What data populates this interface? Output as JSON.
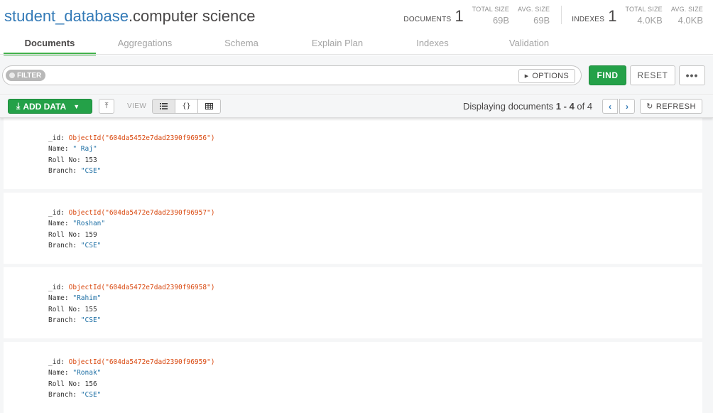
{
  "title": {
    "database": "student_database",
    "collection": ".computer science"
  },
  "stats": {
    "documents_label": "DOCUMENTS",
    "documents_count": "1",
    "doc_total_size_label": "TOTAL SIZE",
    "doc_total_size": "69B",
    "doc_avg_size_label": "AVG. SIZE",
    "doc_avg_size": "69B",
    "indexes_label": "INDEXES",
    "indexes_count": "1",
    "idx_total_size_label": "TOTAL SIZE",
    "idx_total_size": "4.0KB",
    "idx_avg_size_label": "AVG. SIZE",
    "idx_avg_size": "4.0KB"
  },
  "tabs": [
    {
      "label": "Documents",
      "active": true
    },
    {
      "label": "Aggregations"
    },
    {
      "label": "Schema"
    },
    {
      "label": "Explain Plan"
    },
    {
      "label": "Indexes"
    },
    {
      "label": "Validation"
    }
  ],
  "query": {
    "filter_label": "FILTER",
    "filter_value": "",
    "options_label": "OPTIONS",
    "find_label": "FIND",
    "reset_label": "RESET",
    "more_label": "•••"
  },
  "toolbar": {
    "add_data_label": "ADD DATA",
    "view_label": "VIEW",
    "view_modes": [
      "list",
      "json",
      "table"
    ],
    "displaying_prefix": "Displaying documents ",
    "range": "1 - 4",
    "of_text": " of ",
    "total": "4",
    "refresh_label": "REFRESH"
  },
  "field_labels": {
    "id": "_id:",
    "name": "Name:",
    "roll": "Roll No:",
    "branch": "Branch:"
  },
  "documents": [
    {
      "id": "ObjectId(\"604da5452e7dad2390f96956\")",
      "name": "\" Raj\"",
      "roll": "153",
      "branch": "\"CSE\""
    },
    {
      "id": "ObjectId(\"604da5472e7dad2390f96957\")",
      "name": "\"Roshan\"",
      "roll": "159",
      "branch": "\"CSE\""
    },
    {
      "id": "ObjectId(\"604da5472e7dad2390f96958\")",
      "name": "\"Rahim\"",
      "roll": "155",
      "branch": "\"CSE\""
    },
    {
      "id": "ObjectId(\"604da5472e7dad2390f96959\")",
      "name": "\"Ronak\"",
      "roll": "156",
      "branch": "\"CSE\""
    }
  ],
  "colors": {
    "accent_green": "#24a148",
    "link_blue": "#337ab7",
    "objectid": "#d9480f",
    "string": "#1c6ea4"
  }
}
